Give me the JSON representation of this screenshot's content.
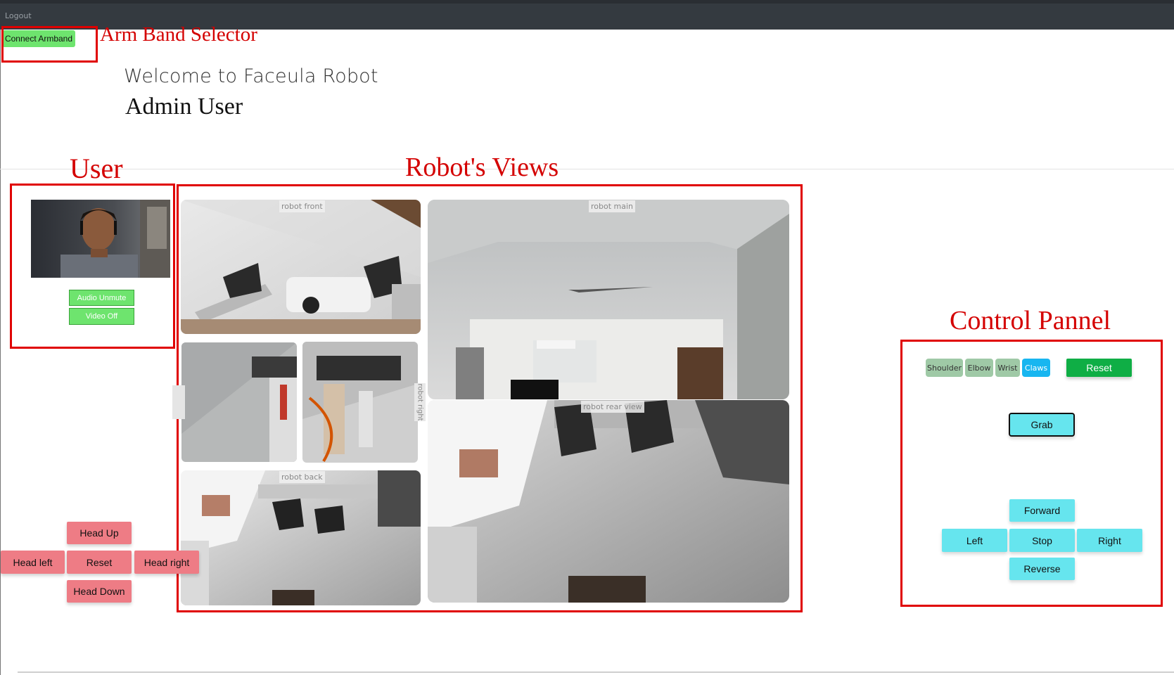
{
  "topbar": {
    "logout_label": "Logout"
  },
  "armband": {
    "connect_label": "Connect Armband",
    "annotation": "Arm Band Selector"
  },
  "welcome": {
    "greeting": "Welcome to Faceula Robot",
    "user_name": "Admin User"
  },
  "sections": {
    "user": "User",
    "robot_views": "Robot's Views",
    "control_panel": "Control Pannel"
  },
  "user_panel": {
    "audio_label": "Audio Unmute",
    "video_label": "Video Off"
  },
  "cameras": {
    "front": "robot front",
    "main": "robot main",
    "right": "robot right",
    "back": "robot back",
    "rear": "robot rear view"
  },
  "head_controls": {
    "up": "Head Up",
    "left": "Head left",
    "reset": "Reset",
    "right": "Head right",
    "down": "Head Down"
  },
  "control_panel": {
    "joints": [
      "Shoulder",
      "Elbow",
      "Wrist",
      "Claws"
    ],
    "active_joint": "Claws",
    "reset_label": "Reset",
    "grab_label": "Grab",
    "forward_label": "Forward",
    "left_label": "Left",
    "stop_label": "Stop",
    "right_label": "Right",
    "reverse_label": "Reverse"
  },
  "colors": {
    "annotation_red": "#e00000",
    "armband_green": "#6ee46e",
    "reset_green": "#0fae45",
    "head_button_pink": "#ee7c85",
    "move_button_cyan": "#66e5ee",
    "active_joint_blue": "#18b6f0"
  }
}
